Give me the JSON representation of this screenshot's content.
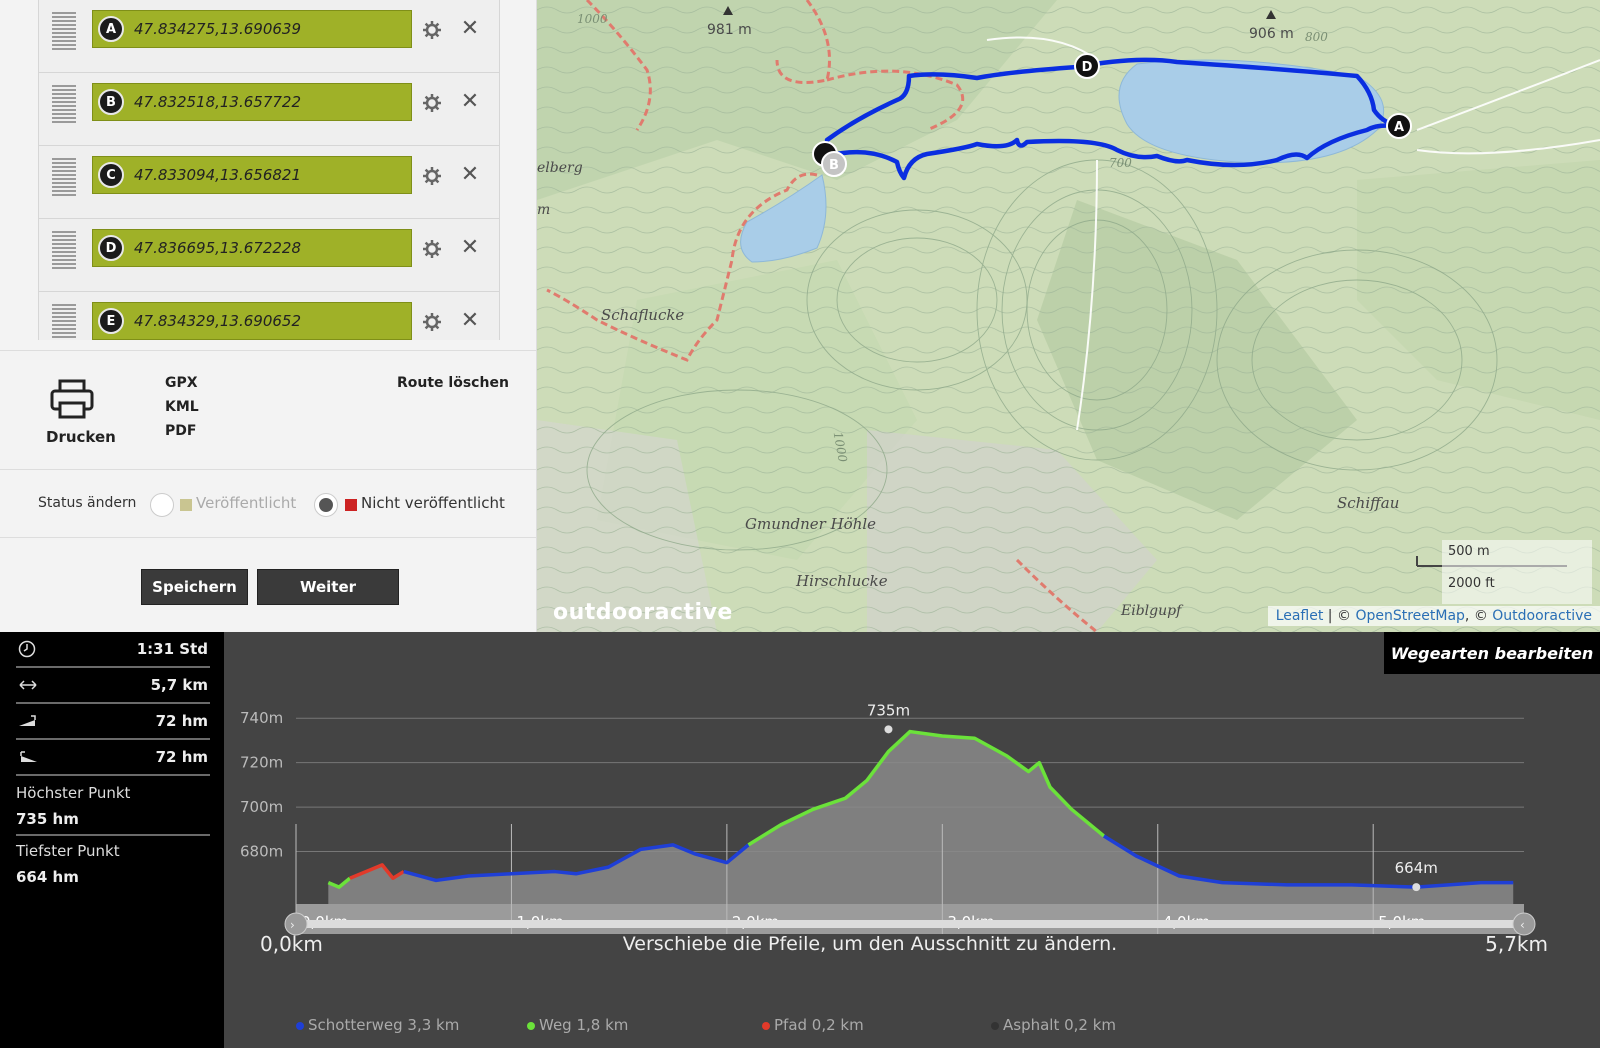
{
  "waypoints": [
    {
      "letter": "A",
      "coords": "47.834275,13.690639"
    },
    {
      "letter": "B",
      "coords": "47.832518,13.657722"
    },
    {
      "letter": "C",
      "coords": "47.833094,13.656821"
    },
    {
      "letter": "D",
      "coords": "47.836695,13.672228"
    },
    {
      "letter": "E",
      "coords": "47.834329,13.690652"
    }
  ],
  "actions": {
    "print_label": "Drucken",
    "export": [
      "GPX",
      "KML",
      "PDF"
    ],
    "delete_route": "Route löschen"
  },
  "status": {
    "label": "Status ändern",
    "published": "Veröffentlicht",
    "unpublished": "Nicht veröffentlicht",
    "published_color": "#c9c591",
    "unpublished_color": "#cc2222"
  },
  "buttons": {
    "save": "Speichern",
    "next": "Weiter"
  },
  "map": {
    "labels": [
      "981 m",
      "906 m",
      "1000",
      "800",
      "700",
      "elberg",
      "m",
      "Schaflucke",
      "Gmundner Höhle",
      "Hirschlucke",
      "Schiffau",
      "Eiblgupf",
      "1000"
    ],
    "markers": [
      "D",
      "A",
      "C",
      "B"
    ],
    "scale_metric": "500 m",
    "scale_imperial": "2000 ft",
    "attribution": {
      "leaflet": "Leaflet",
      "sep": " | © ",
      "osm": "OpenStreetMap",
      "sep2": ", © ",
      "oa": "Outdooractive"
    },
    "brand": "outdooractive",
    "route_color": "#0a2ee0"
  },
  "stats": {
    "duration": "1:31 Std",
    "distance": "5,7 km",
    "ascent": "72 hm",
    "descent": "72 hm",
    "highest_label": "Höchster Punkt",
    "highest_value": "735 hm",
    "lowest_label": "Tiefster Punkt",
    "lowest_value": "664 hm",
    "icons": [
      "clock-icon",
      "distance-icon",
      "ascent-icon",
      "descent-icon"
    ]
  },
  "profile": {
    "edit_waytypes": "Wegearten bearbeiten",
    "range_start": "0,0km",
    "range_end": "5,7km",
    "hint": "Verschiebe die Pfeile, um den Ausschnitt zu ändern.",
    "max_label": "735m",
    "min_label": "664m",
    "legend": [
      {
        "label": "Schotterweg 3,3 km",
        "color": "#1f3fd6"
      },
      {
        "label": "Weg 1,8 km",
        "color": "#6be23a"
      },
      {
        "label": "Pfad 0,2 km",
        "color": "#e23a2a"
      },
      {
        "label": "Asphalt 0,2 km",
        "color": "#333333"
      }
    ]
  },
  "chart_data": {
    "type": "area",
    "xlabel": "",
    "ylabel": "",
    "xlim": [
      0,
      5.7
    ],
    "ylim": [
      660,
      750
    ],
    "x_ticks": [
      "0,0km",
      "1,0km",
      "2,0km",
      "3,0km",
      "4,0km",
      "5,0km"
    ],
    "x_tick_values": [
      0,
      1,
      2,
      3,
      4,
      5
    ],
    "y_ticks": [
      "680m",
      "700m",
      "720m",
      "740m"
    ],
    "y_tick_values": [
      680,
      700,
      720,
      740
    ],
    "series": [
      {
        "name": "Weg",
        "x": [
          0.15,
          0.2,
          0.25
        ],
        "y": [
          666,
          664,
          668
        ]
      },
      {
        "name": "Pfad",
        "x": [
          0.25,
          0.35,
          0.4,
          0.45,
          0.5
        ],
        "y": [
          668,
          672,
          674,
          668,
          671
        ]
      },
      {
        "name": "Schotterweg",
        "x": [
          0.5,
          0.65,
          0.8,
          1.0,
          1.2,
          1.3,
          1.45,
          1.6,
          1.75,
          1.85,
          2.0,
          2.1
        ],
        "y": [
          671,
          667,
          669,
          670,
          671,
          670,
          673,
          681,
          683,
          679,
          675,
          683
        ]
      },
      {
        "name": "Weg",
        "x": [
          2.1,
          2.25,
          2.4,
          2.55,
          2.65,
          2.75,
          2.85,
          3.0,
          3.15,
          3.3,
          3.4,
          3.45,
          3.5,
          3.6,
          3.75
        ],
        "y": [
          683,
          692,
          699,
          704,
          712,
          725,
          734,
          732,
          731,
          723,
          716,
          720,
          709,
          699,
          687
        ]
      },
      {
        "name": "Schotterweg",
        "x": [
          3.75,
          3.9,
          4.1,
          4.3,
          4.6,
          4.9,
          5.2,
          5.5,
          5.65
        ],
        "y": [
          687,
          678,
          669,
          666,
          665,
          665,
          664,
          666,
          666
        ]
      }
    ],
    "annotations": [
      {
        "text": "735m",
        "x": 2.75,
        "y": 735
      },
      {
        "text": "664m",
        "x": 5.2,
        "y": 664
      }
    ]
  }
}
